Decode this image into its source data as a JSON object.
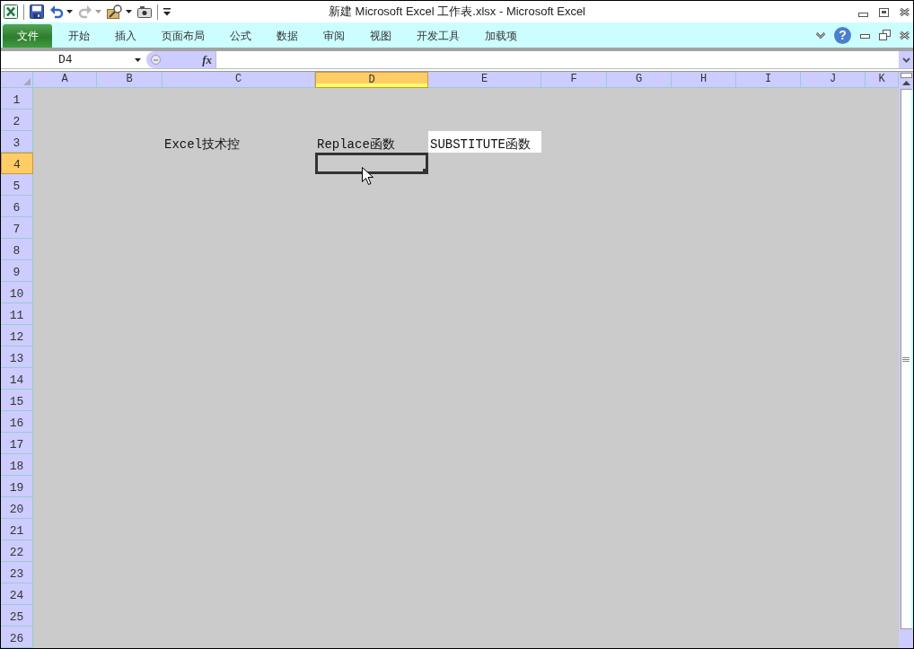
{
  "window": {
    "title": "新建 Microsoft Excel 工作表.xlsx - Microsoft Excel"
  },
  "quick_access_toolbar": [
    {
      "kind": "save",
      "disabled": false,
      "dropdown": false
    },
    {
      "kind": "undo",
      "disabled": false,
      "dropdown": true
    },
    {
      "kind": "redo",
      "disabled": true,
      "dropdown": true
    },
    {
      "kind": "tools",
      "disabled": false,
      "dropdown": true
    },
    {
      "kind": "camera",
      "disabled": false,
      "dropdown": false
    }
  ],
  "ribbon": {
    "tabs": [
      {
        "label": "文件",
        "kind": "file",
        "selected": false
      },
      {
        "label": "开始",
        "kind": "tab",
        "selected": false
      },
      {
        "label": "插入",
        "kind": "tab",
        "selected": false
      },
      {
        "label": "页面布局",
        "kind": "tab",
        "selected": false
      },
      {
        "label": "公式",
        "kind": "tab",
        "selected": false
      },
      {
        "label": "数据",
        "kind": "tab",
        "selected": false
      },
      {
        "label": "审阅",
        "kind": "tab",
        "selected": false
      },
      {
        "label": "视图",
        "kind": "tab",
        "selected": false
      },
      {
        "label": "开发工具",
        "kind": "tab",
        "selected": false
      },
      {
        "label": "加载项",
        "kind": "tab",
        "selected": false
      }
    ],
    "help": "?"
  },
  "formula_bar": {
    "name_box": "D4",
    "function_label": "fx"
  },
  "sheet": {
    "columns": [
      {
        "label": "A",
        "selected": false
      },
      {
        "label": "B",
        "selected": false
      },
      {
        "label": "C",
        "selected": false
      },
      {
        "label": "D",
        "selected": true
      },
      {
        "label": "E",
        "selected": false
      },
      {
        "label": "F",
        "selected": false
      },
      {
        "label": "G",
        "selected": false
      },
      {
        "label": "H",
        "selected": false
      },
      {
        "label": "I",
        "selected": false
      },
      {
        "label": "J",
        "selected": false
      },
      {
        "label": "K",
        "selected": false
      }
    ],
    "rows": [
      {
        "label": "1",
        "selected": false
      },
      {
        "label": "2",
        "selected": false
      },
      {
        "label": "3",
        "selected": false,
        "cells": [
          {},
          {},
          {
            "text": "Excel技术控"
          },
          {
            "text": "Replace函数"
          },
          {
            "text": "SUBSTITUTE函数",
            "color": "#ffffff"
          }
        ]
      },
      {
        "label": "4",
        "selected": true
      },
      {
        "label": "5",
        "selected": false
      },
      {
        "label": "6",
        "selected": false
      },
      {
        "label": "7",
        "selected": false
      },
      {
        "label": "8",
        "selected": false
      },
      {
        "label": "9",
        "selected": false
      },
      {
        "label": "10",
        "selected": false
      },
      {
        "label": "11",
        "selected": false
      },
      {
        "label": "12",
        "selected": false
      },
      {
        "label": "13",
        "selected": false
      },
      {
        "label": "14",
        "selected": false
      },
      {
        "label": "15",
        "selected": false
      },
      {
        "label": "16",
        "selected": false
      },
      {
        "label": "17",
        "selected": false
      },
      {
        "label": "18",
        "selected": false
      },
      {
        "label": "19",
        "selected": false
      },
      {
        "label": "20",
        "selected": false
      },
      {
        "label": "21",
        "selected": false
      },
      {
        "label": "22",
        "selected": false
      },
      {
        "label": "23",
        "selected": false
      },
      {
        "label": "24",
        "selected": false
      },
      {
        "label": "25",
        "selected": false
      },
      {
        "label": "26",
        "selected": false
      }
    ]
  }
}
